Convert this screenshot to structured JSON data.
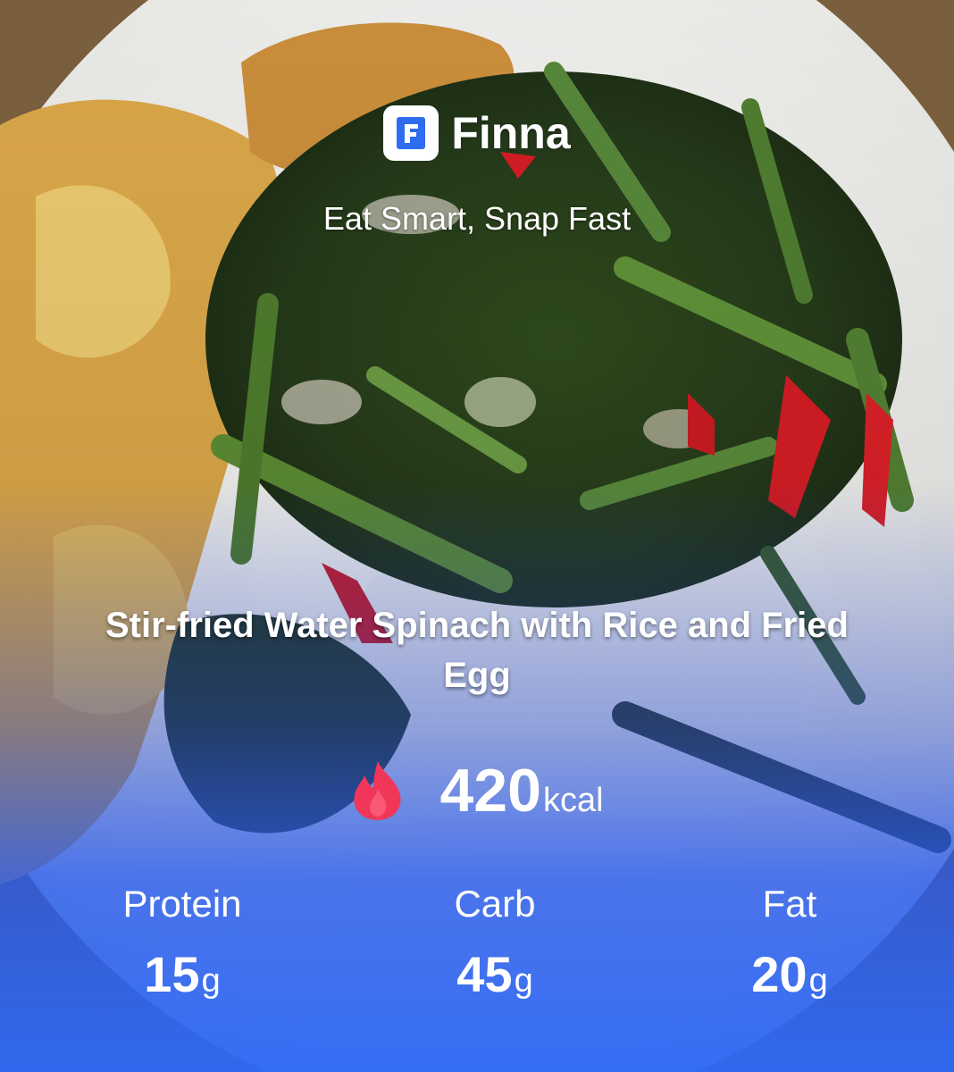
{
  "app": {
    "name": "Finna",
    "logo_letter": "F",
    "tagline": "Eat Smart, Snap Fast"
  },
  "dish": {
    "title": "Stir-fried Water Spinach with Rice and Fried Egg"
  },
  "calories": {
    "value": "420",
    "unit": "kcal",
    "icon": "flame-icon"
  },
  "macros": [
    {
      "label": "Protein",
      "value": "15",
      "unit": "g"
    },
    {
      "label": "Carb",
      "value": "45",
      "unit": "g"
    },
    {
      "label": "Fat",
      "value": "20",
      "unit": "g"
    }
  ],
  "colors": {
    "brand_blue": "#2f6cf0",
    "flame": "#f0375a",
    "overlay_blue": "#2d69f5"
  }
}
